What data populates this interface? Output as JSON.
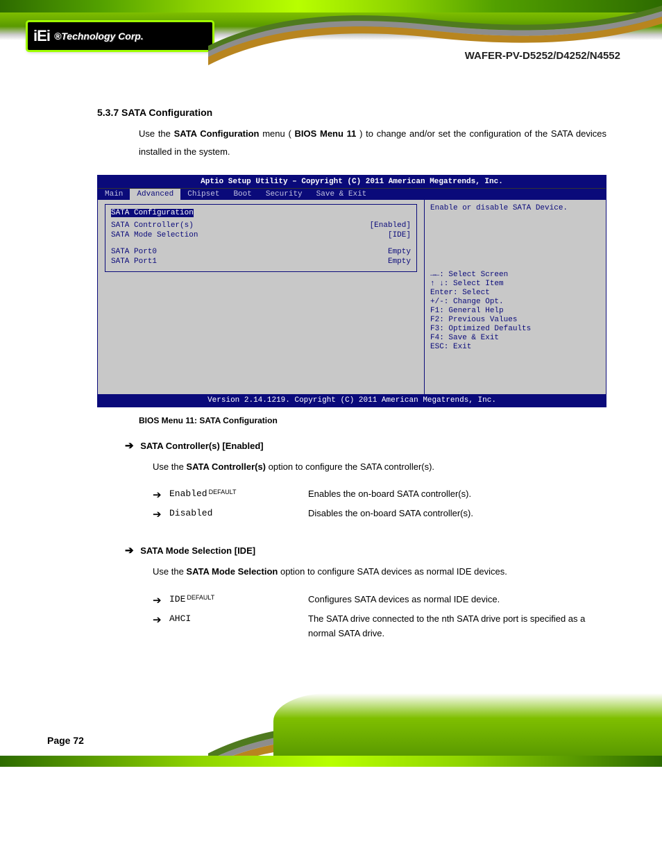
{
  "header": {
    "doc_title": "WAFER-PV-D5252/D4252/N4552"
  },
  "intro": {
    "section_heading": "5.3.7 SATA Configuration",
    "prefix": "Use   the ",
    "menu_bold": "SATA  Configuration",
    "mid": "  menu  (",
    "ref_bold": "BIOS Menu 11",
    "suffix": ")  to  change  and/or  set  the  configuration of the SATA devices installed in the system."
  },
  "bios": {
    "title": "Aptio Setup Utility – Copyright (C) 2011 American Megatrends, Inc.",
    "tabs": [
      "Main",
      "Advanced",
      "Chipset",
      "Boot",
      "Security",
      "Save & Exit"
    ],
    "active_tab": 1,
    "panel_heading": "SATA Configuration",
    "rows": [
      {
        "k": "SATA Controller(s)",
        "v": "[Enabled]"
      },
      {
        "k": "SATA Mode Selection",
        "v": "[IDE]"
      }
    ],
    "ports": [
      {
        "k": "SATA Port0",
        "v": "Empty"
      },
      {
        "k": "SATA Port1",
        "v": "Empty"
      }
    ],
    "help": "Enable or disable SATA Device.",
    "keys": [
      "→←: Select Screen",
      "↑ ↓: Select Item",
      "Enter: Select",
      "+/-: Change Opt.",
      "F1: General Help",
      "F2: Previous Values",
      "F3: Optimized Defaults",
      "F4: Save & Exit",
      "ESC: Exit"
    ],
    "footer": "Version 2.14.1219. Copyright (C) 2011 American Megatrends, Inc."
  },
  "caption": "BIOS Menu 11: SATA Configuration",
  "opts": [
    {
      "heading": "SATA Controller(s) [Enabled]",
      "intro_prefix": "Use the ",
      "intro_bold": "SATA Controller(s)",
      "intro_suffix": " option to configure the SATA controller(s).",
      "items": [
        {
          "name": "Enabled",
          "tag": "DEFAULT",
          "desc": "Enables the on-board SATA controller(s)."
        },
        {
          "name": "Disabled",
          "tag": "",
          "desc": "Disables the on-board SATA controller(s)."
        }
      ]
    },
    {
      "heading": "SATA Mode Selection [IDE]",
      "intro_prefix": "Use the ",
      "intro_bold": "SATA Mode Selection",
      "intro_suffix": " option to configure SATA devices as normal IDE devices.",
      "items": [
        {
          "name": "IDE",
          "tag": "DEFAULT",
          "desc": "Configures SATA devices as normal IDE device."
        },
        {
          "name": "AHCI",
          "tag": "",
          "desc": "The SATA drive connected to the nth SATA drive port is specified as a normal SATA drive."
        }
      ]
    }
  ],
  "page_number": "Page 72"
}
